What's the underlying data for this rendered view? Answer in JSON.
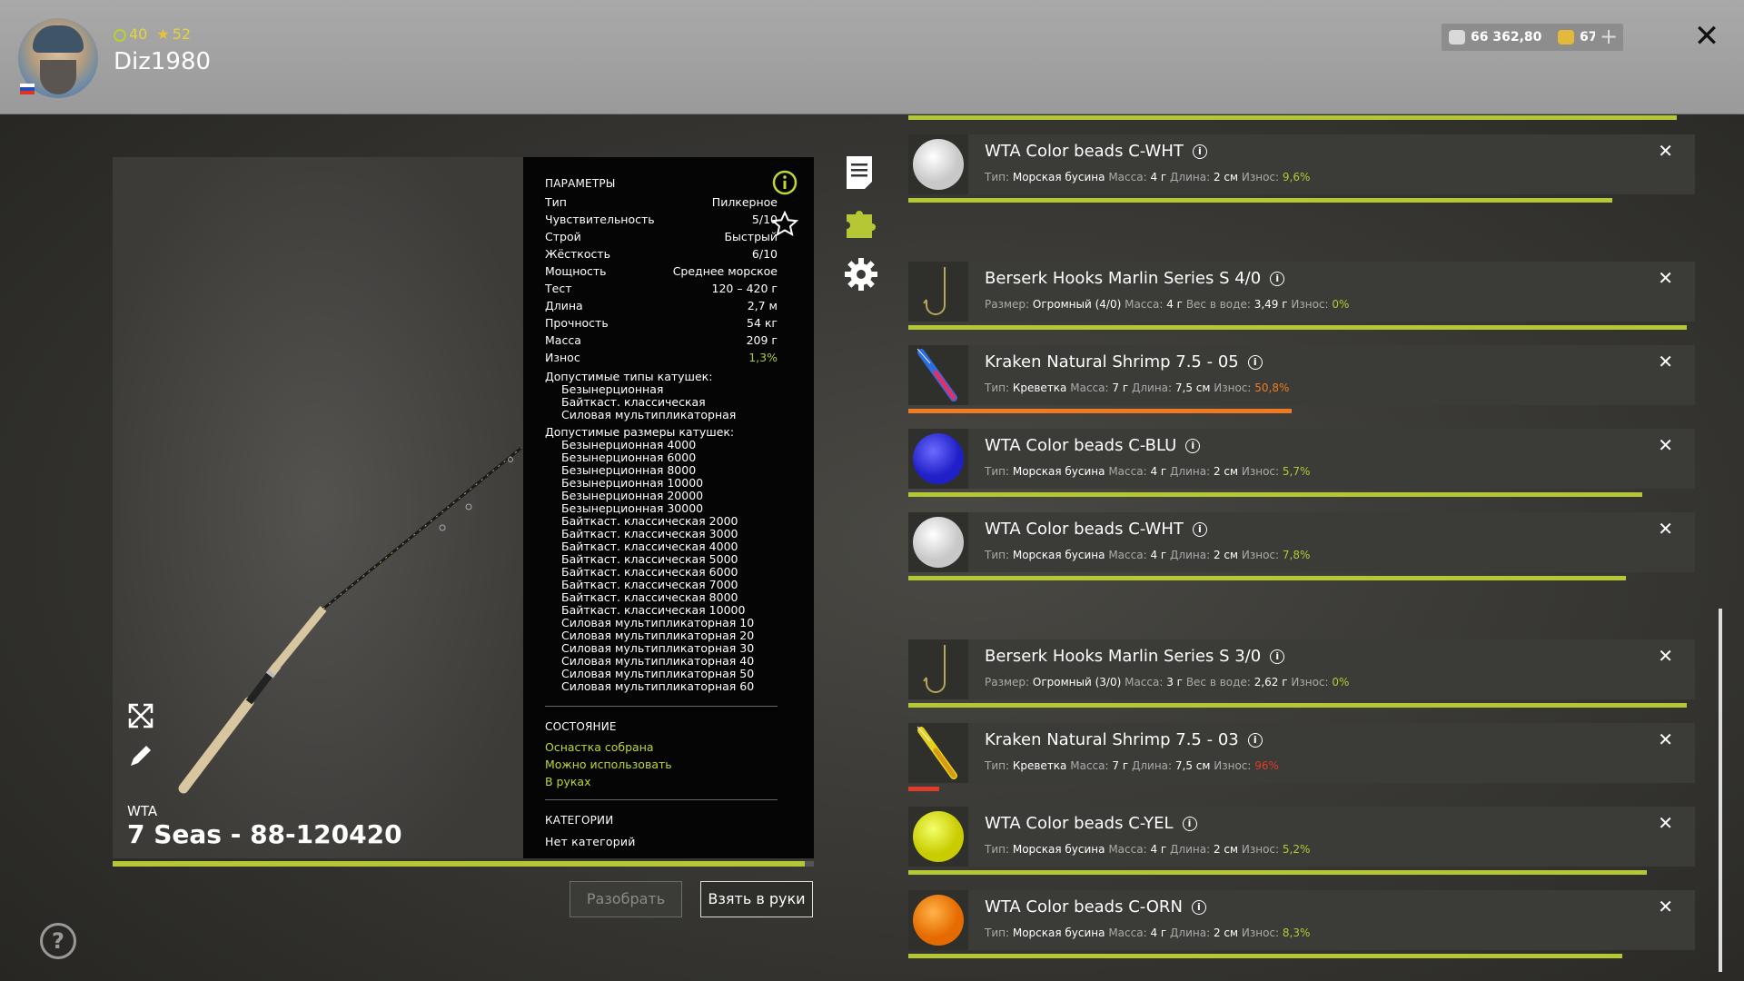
{
  "header": {
    "level": "40",
    "rank": "52",
    "username": "Diz1980",
    "currency_silver": "66 362,80",
    "currency_gold": "67,35",
    "plus": "+",
    "close": "✕"
  },
  "rod": {
    "brand": "WTA",
    "name": "7 Seas - 88-120420",
    "durability_fraction": 0.987
  },
  "params": {
    "heading": "ПАРАМЕТРЫ",
    "rows": [
      {
        "label": "Тип",
        "value": "Пилкерное"
      },
      {
        "label": "Чувствительность",
        "value": "5/10"
      },
      {
        "label": "Строй",
        "value": "Быстрый"
      },
      {
        "label": "Жёсткость",
        "value": "6/10"
      },
      {
        "label": "Мощность",
        "value": "Среднее морское"
      },
      {
        "label": "Тест",
        "value": "120 – 420 г"
      },
      {
        "label": "Длина",
        "value": "2,7 м"
      },
      {
        "label": "Прочность",
        "value": "54 кг"
      },
      {
        "label": "Масса",
        "value": "209 г"
      },
      {
        "label": "Износ",
        "value": "1,3%"
      }
    ],
    "reel_types_label": "Допустимые типы катушек:",
    "reel_types": [
      "Безынерционная",
      "Байткаст. классическая",
      "Силовая мультипликаторная"
    ],
    "reel_sizes_label": "Допустимые размеры катушек:",
    "reel_sizes": [
      "Безынерционная 4000",
      "Безынерционная 6000",
      "Безынерционная 8000",
      "Безынерционная 10000",
      "Безынерционная 20000",
      "Безынерционная 30000",
      "Байткаст. классическая 2000",
      "Байткаст. классическая 3000",
      "Байткаст. классическая 4000",
      "Байткаст. классическая 5000",
      "Байткаст. классическая 6000",
      "Байткаст. классическая 7000",
      "Байткаст. классическая 8000",
      "Байткаст. классическая 10000",
      "Силовая мультипликаторная 10",
      "Силовая мультипликаторная 20",
      "Силовая мультипликаторная 30",
      "Силовая мультипликаторная 40",
      "Силовая мультипликаторная 50",
      "Силовая мультипликаторная 60"
    ],
    "state_heading": "СОСТОЯНИЕ",
    "states": [
      "Оснастка собрана",
      "Можно использовать",
      "В руках"
    ],
    "categories_heading": "КАТЕГОРИИ",
    "categories": "Нет категорий"
  },
  "buttons": {
    "disassemble": "Разобрать",
    "take": "Взять в руки"
  },
  "help": "?",
  "colors": {
    "accent": "#b5c734",
    "orange": "#ee7a24",
    "red": "#e03a2a"
  },
  "items": [
    {
      "title": "WTA Color beads C-WHT",
      "details": [
        [
          "Тип:",
          "Морская бусина"
        ],
        [
          "Масса:",
          "4 г"
        ],
        [
          "Длина:",
          "2 см"
        ]
      ],
      "wear_label": "Износ:",
      "wear": "9,6%",
      "wear_class": "g",
      "thumb": "bead-white",
      "durability": 0.904,
      "bar_color": "#b5c734"
    },
    {
      "title": "Berserk Hooks Marlin Series S 4/0",
      "details": [
        [
          "Размер:",
          "Огромный (4/0)"
        ],
        [
          "Масса:",
          "4 г"
        ],
        [
          "Вес в воде:",
          "3,49 г"
        ]
      ],
      "wear_label": "Износ:",
      "wear": "0%",
      "wear_class": "g",
      "thumb": "hook",
      "durability": 1.0,
      "bar_color": "#b5c734"
    },
    {
      "title": "Kraken Natural Shrimp 7.5 - 05",
      "details": [
        [
          "Тип:",
          "Креветка"
        ],
        [
          "Масса:",
          "7 г"
        ],
        [
          "Длина:",
          "7,5 см"
        ]
      ],
      "wear_label": "Износ:",
      "wear": "50,8%",
      "wear_class": "o",
      "thumb": "shrimp-blue",
      "durability": 0.492,
      "bar_color": "#ee7a24"
    },
    {
      "title": "WTA Color beads C-BLU",
      "details": [
        [
          "Тип:",
          "Морская бусина"
        ],
        [
          "Масса:",
          "4 г"
        ],
        [
          "Длина:",
          "2 см"
        ]
      ],
      "wear_label": "Износ:",
      "wear": "5,7%",
      "wear_class": "g",
      "thumb": "bead-blue",
      "durability": 0.943,
      "bar_color": "#b5c734"
    },
    {
      "title": "WTA Color beads C-WHT",
      "details": [
        [
          "Тип:",
          "Морская бусина"
        ],
        [
          "Масса:",
          "4 г"
        ],
        [
          "Длина:",
          "2 см"
        ]
      ],
      "wear_label": "Износ:",
      "wear": "7,8%",
      "wear_class": "g",
      "thumb": "bead-white",
      "durability": 0.922,
      "bar_color": "#b5c734"
    },
    {
      "title": "Berserk Hooks Marlin Series S 3/0",
      "details": [
        [
          "Размер:",
          "Огромный (3/0)"
        ],
        [
          "Масса:",
          "3 г"
        ],
        [
          "Вес в воде:",
          "2,62 г"
        ]
      ],
      "wear_label": "Износ:",
      "wear": "0%",
      "wear_class": "g",
      "thumb": "hook",
      "durability": 1.0,
      "bar_color": "#b5c734"
    },
    {
      "title": "Kraken Natural Shrimp 7.5 - 03",
      "details": [
        [
          "Тип:",
          "Креветка"
        ],
        [
          "Масса:",
          "7 г"
        ],
        [
          "Длина:",
          "7,5 см"
        ]
      ],
      "wear_label": "Износ:",
      "wear": "96%",
      "wear_class": "r",
      "thumb": "shrimp-yellow",
      "durability": 0.04,
      "bar_color": "#e03a2a"
    },
    {
      "title": "WTA Color beads C-YEL",
      "details": [
        [
          "Тип:",
          "Морская бусина"
        ],
        [
          "Масса:",
          "4 г"
        ],
        [
          "Длина:",
          "2 см"
        ]
      ],
      "wear_label": "Износ:",
      "wear": "5,2%",
      "wear_class": "g",
      "thumb": "bead-yellow",
      "durability": 0.948,
      "bar_color": "#b5c734"
    },
    {
      "title": "WTA Color beads C-ORN",
      "details": [
        [
          "Тип:",
          "Морская бусина"
        ],
        [
          "Масса:",
          "4 г"
        ],
        [
          "Длина:",
          "2 см"
        ]
      ],
      "wear_label": "Износ:",
      "wear": "8,3%",
      "wear_class": "g",
      "thumb": "bead-orange",
      "durability": 0.917,
      "bar_color": "#b5c734"
    }
  ]
}
